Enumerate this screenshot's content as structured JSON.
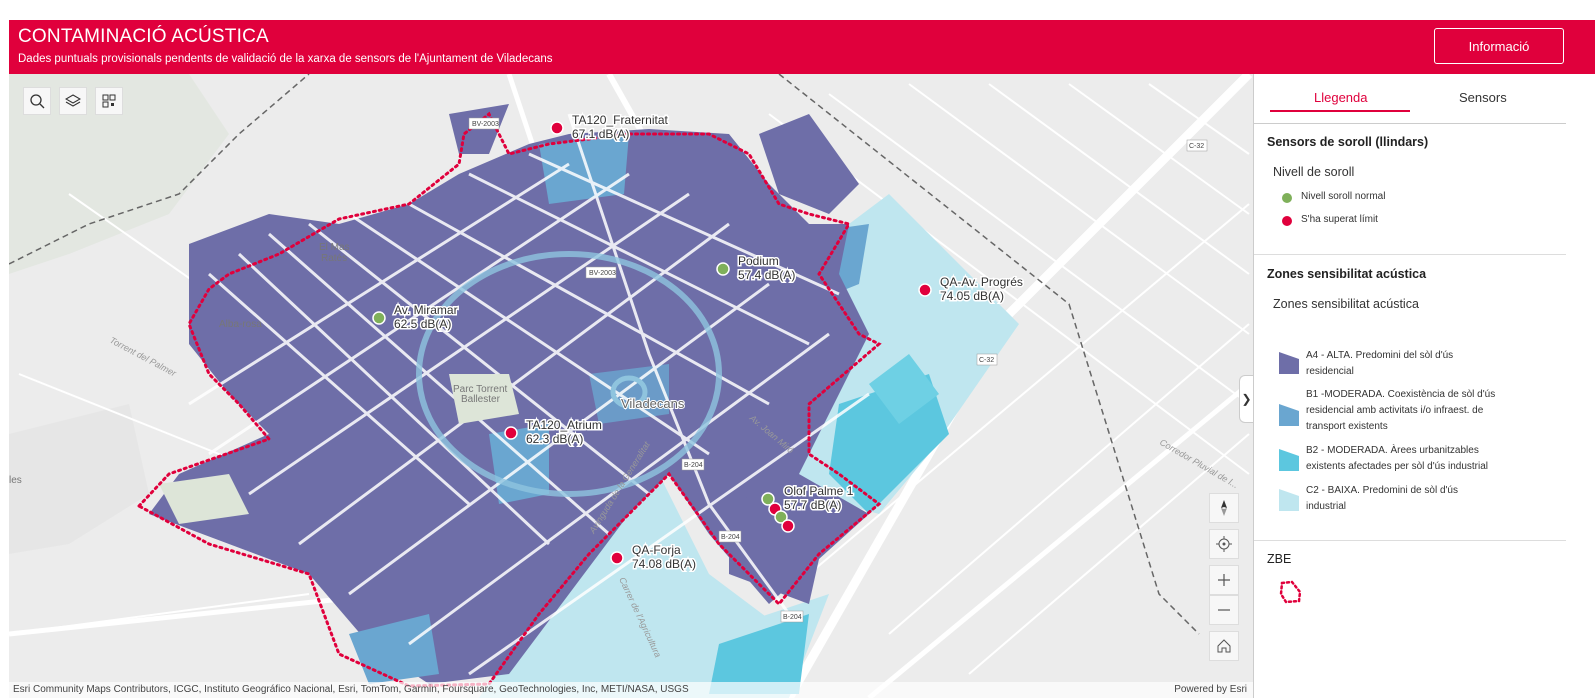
{
  "header": {
    "title": "CONTAMINACIÓ ACÚSTICA",
    "subtitle": "Dades puntuals provisionals pendents de validació de la xarxa de sensors de l'Ajuntament de Viladecans",
    "info_button": "Informació"
  },
  "map": {
    "toolbar": [
      "search-icon",
      "layers-icon",
      "qr-icon"
    ],
    "sensors": [
      {
        "name": "TA120_Fraternitat",
        "value": "67.1 dB(A)",
        "status": "over"
      },
      {
        "name": "Podium",
        "value": "57.4 dB(A)",
        "status": "normal"
      },
      {
        "name": "QA-Av. Progrés",
        "value": "74.05 dB(A)",
        "status": "over"
      },
      {
        "name": "Av. Miramar",
        "value": "62.5 dB(A)",
        "status": "normal"
      },
      {
        "name": "TA120_Atrium",
        "value": "62.3 dB(A)",
        "status": "over"
      },
      {
        "name": "Olof Palme 1",
        "value": "57.7 dB(A)",
        "status": "normal"
      },
      {
        "name": "QA-Forja",
        "value": "74.08 dB(A)",
        "status": "over"
      }
    ],
    "places": {
      "city": "Viladecans",
      "mas_line1": "El Mas",
      "mas_line2": "Ratés",
      "albarrosa": "Alba-rosa",
      "parc_line1": "Parc Torrent",
      "parc_line2": "Ballester",
      "torrent": "Torrent del Palmer",
      "corredor": "Corredor Pluvial de l...",
      "les": "les",
      "av_gleva": "Avinguda de la Generalitat",
      "carrer_agri": "Carrer de l'Agricultura",
      "joan_miro": "Av. Joan Miró"
    },
    "roads": {
      "bv2003a": "BV-2003",
      "bv2003b": "BV-2003",
      "c32a": "C-32",
      "c32b": "C-32",
      "b204a": "B-204",
      "b204b": "B-204",
      "b204c": "B-204"
    },
    "attribution": "Esri Community Maps Contributors, ICGC, Instituto Geográfico Nacional, Esri, TomTom, Garmin, Foursquare, GeoTechnologies, Inc, METI/NASA, USGS",
    "powered_by": "Powered by Esri",
    "colors": {
      "over": "#e0003c",
      "normal": "#7fb05a"
    }
  },
  "panel": {
    "tabs": {
      "legend": "Llegenda",
      "sensors": "Sensors"
    },
    "section1": {
      "title": "Sensors de soroll (llindars)",
      "subtitle": "Nivell de soroll",
      "items": [
        {
          "label": "Nivell soroll normal",
          "color": "#7fb05a"
        },
        {
          "label": "S'ha superat límit",
          "color": "#e0003c"
        }
      ]
    },
    "section2": {
      "title": "Zones sensibilitat acústica",
      "subtitle": "Zones sensibilitat acústica",
      "items": [
        {
          "line1": "A4 - ALTA. Predomini del sòl d'ús",
          "line2": "residencial",
          "line3": "",
          "color": "#6e6ea8"
        },
        {
          "line1": "B1 -MODERADA. Coexistència de sòl d'ús",
          "line2": "residencial amb activitats i/o infraest. de",
          "line3": "transport existents",
          "color": "#6aa6d0"
        },
        {
          "line1": "B2 - MODERADA. Àrees urbanitzables",
          "line2": "existents afectades per sòl d'ús industrial",
          "line3": "",
          "color": "#5cc7df"
        },
        {
          "line1": "C2 - BAIXA. Predomini de sòl d'ús",
          "line2": "industrial",
          "line3": "",
          "color": "#bfe6ef"
        }
      ]
    },
    "section3": {
      "title": "ZBE"
    }
  }
}
